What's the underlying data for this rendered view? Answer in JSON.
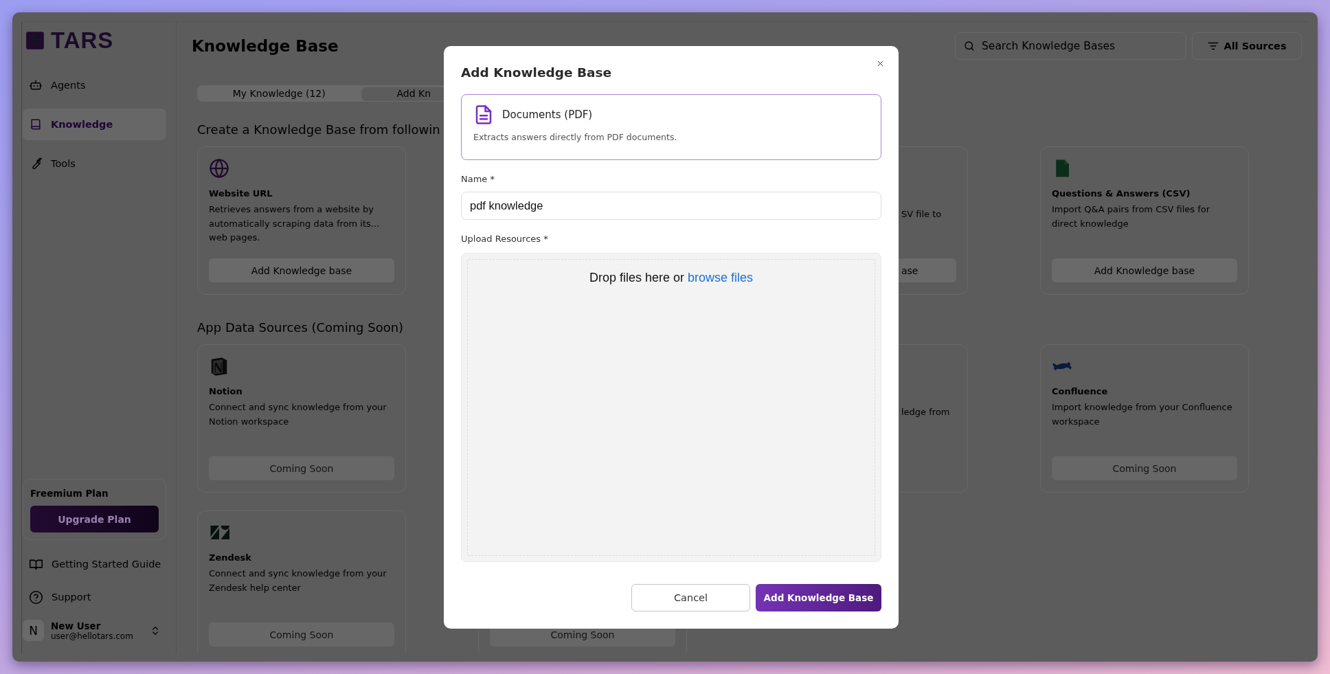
{
  "sidebar": {
    "logo": "TARS",
    "nav": [
      {
        "label": "Agents",
        "selected": false
      },
      {
        "label": "Knowledge",
        "selected": true
      },
      {
        "label": "Tools",
        "selected": false
      }
    ],
    "plan": {
      "title": "Freemium Plan",
      "button": "Upgrade Plan"
    },
    "links": [
      {
        "label": "Getting Started Guide"
      },
      {
        "label": "Support"
      }
    ],
    "user": {
      "initial": "N",
      "name": "New User",
      "email": "user@hellotars.com"
    }
  },
  "header": {
    "title": "Knowledge Base",
    "search": {
      "placeholder": "Search Knowledge Bases"
    },
    "filter": "All Sources"
  },
  "tabs": [
    {
      "label": "My Knowledge (12)",
      "selected": false
    },
    {
      "label": "Add Kn",
      "selected": true
    }
  ],
  "sections": [
    {
      "heading": "Create a Knowledge Base from followin",
      "cards": [
        {
          "kind": "source",
          "title": "Website URL",
          "description": "Retrieves answers from a website by automatically scraping data from its... web pages.",
          "button": {
            "label": "Add Knowledge base",
            "disabled": false
          }
        },
        {
          "kind": "covered"
        },
        {
          "kind": "tail",
          "description": "SV file to",
          "button": {
            "label": "ase",
            "disabled": false
          }
        },
        {
          "kind": "source",
          "title": "Questions & Answers (CSV)",
          "description": "Import Q&A pairs from CSV files for direct knowledge",
          "button": {
            "label": "Add Knowledge base",
            "disabled": false
          }
        }
      ]
    },
    {
      "heading": "App Data Sources (Coming Soon)",
      "cards": [
        {
          "kind": "source",
          "title": "Notion",
          "description": "Connect and sync knowledge from your Notion workspace",
          "button": {
            "label": "Coming Soon",
            "disabled": true
          }
        },
        {
          "kind": "covered"
        },
        {
          "kind": "tail",
          "description": "ledge from"
        },
        {
          "kind": "source",
          "title": "Confluence",
          "description": "Import knowledge from your Confluence workspace",
          "button": {
            "label": "Coming Soon",
            "disabled": true
          }
        },
        {
          "kind": "source",
          "title": "Zendesk",
          "description": "Connect and sync knowledge from your Zendesk help center",
          "button": {
            "label": "Coming Soon",
            "disabled": true
          }
        },
        {
          "kind": "foot",
          "button": {
            "label": "Coming Soon",
            "disabled": true
          }
        }
      ]
    }
  ],
  "modal": {
    "title": "Add Knowledge Base",
    "source": {
      "title": "Documents (PDF)",
      "description": "Extracts answers directly from PDF documents.",
      "selected": true
    },
    "name_field": {
      "label": "Name *",
      "value": "pdf knowledge"
    },
    "upload": {
      "label": "Upload Resources *",
      "text": "Drop files here or",
      "link": "browse files"
    },
    "buttons": [
      {
        "label": "Cancel",
        "kind": "secondary"
      },
      {
        "label": "Add Knowledge Base",
        "kind": "primary"
      }
    ]
  }
}
